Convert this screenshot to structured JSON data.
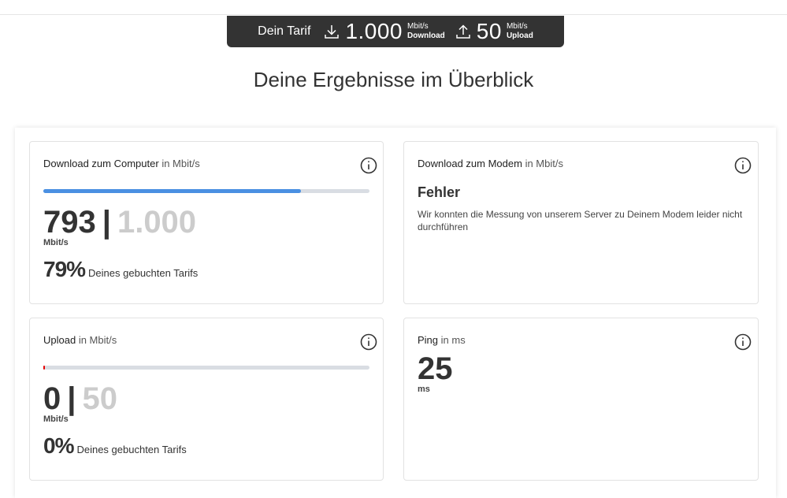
{
  "tariff": {
    "label": "Dein Tarif",
    "download_value": "1.000",
    "download_unit": "Mbit/s",
    "download_label": "Download",
    "upload_value": "50",
    "upload_unit": "Mbit/s",
    "upload_label": "Upload"
  },
  "title": "Deine Ergebnisse im Überblick",
  "cards": {
    "download_computer": {
      "title": "Download zum Computer",
      "unit": "in Mbit/s",
      "value": "793",
      "separator": "|",
      "total": "1.000",
      "value_unit": "Mbit/s",
      "percent": "79%",
      "percent_label": "Deines gebuchten Tarifs",
      "progress": 0.79,
      "progress_color": "#4a90e2"
    },
    "download_modem": {
      "title": "Download zum Modem",
      "unit": "in Mbit/s",
      "error_title": "Fehler",
      "error_text": "Wir konnten die Messung von unserem Server zu Deinem Modem leider nicht durchführen"
    },
    "upload": {
      "title": "Upload",
      "unit": "in Mbit/s",
      "value": "0",
      "separator": "|",
      "total": "50",
      "value_unit": "Mbit/s",
      "percent": "0%",
      "percent_label": "Deines gebuchten Tarifs",
      "progress": 0.0,
      "progress_color": "#e60000"
    },
    "ping": {
      "title": "Ping",
      "unit": "in ms",
      "value": "25",
      "value_unit": "ms"
    }
  },
  "icons": {
    "download": "download-arrow-icon",
    "upload": "upload-arrow-icon",
    "info": "info-circle-icon"
  }
}
